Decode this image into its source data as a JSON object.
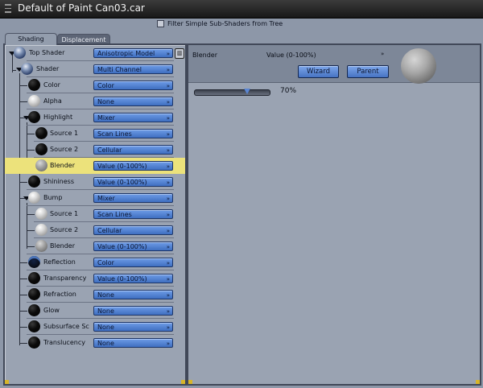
{
  "window": {
    "title": "Default of Paint Can03.car"
  },
  "filter": {
    "label": "Filter Simple Sub-Shaders from Tree"
  },
  "tabs": [
    {
      "label": "Shading"
    },
    {
      "label": "Displacement"
    }
  ],
  "tree": [
    {
      "label": "Top Shader",
      "value": "Anisotropic Model"
    },
    {
      "label": "Shader",
      "value": "Multi Channel"
    },
    {
      "label": "Color",
      "value": "Color"
    },
    {
      "label": "Alpha",
      "value": "None"
    },
    {
      "label": "Highlight",
      "value": "Mixer"
    },
    {
      "label": "Source 1",
      "value": "Scan Lines"
    },
    {
      "label": "Source 2",
      "value": "Cellular"
    },
    {
      "label": "Blender",
      "value": "Value (0-100%)"
    },
    {
      "label": "Shininess",
      "value": "Value (0-100%)"
    },
    {
      "label": "Bump",
      "value": "Mixer"
    },
    {
      "label": "Source 1",
      "value": "Scan Lines"
    },
    {
      "label": "Source 2",
      "value": "Cellular"
    },
    {
      "label": "Blender",
      "value": "Value (0-100%)"
    },
    {
      "label": "Reflection",
      "value": "Color"
    },
    {
      "label": "Transparency",
      "value": "Value (0-100%)"
    },
    {
      "label": "Refraction",
      "value": "None"
    },
    {
      "label": "Glow",
      "value": "None"
    },
    {
      "label": "Subsurface Sc",
      "value": "None"
    },
    {
      "label": "Translucency",
      "value": "None"
    }
  ],
  "detail": {
    "name": "Blender",
    "type": "Value (0-100%)",
    "wizard_label": "Wizard",
    "parent_label": "Parent",
    "slider_value": 0.7,
    "slider_text": "70%"
  }
}
